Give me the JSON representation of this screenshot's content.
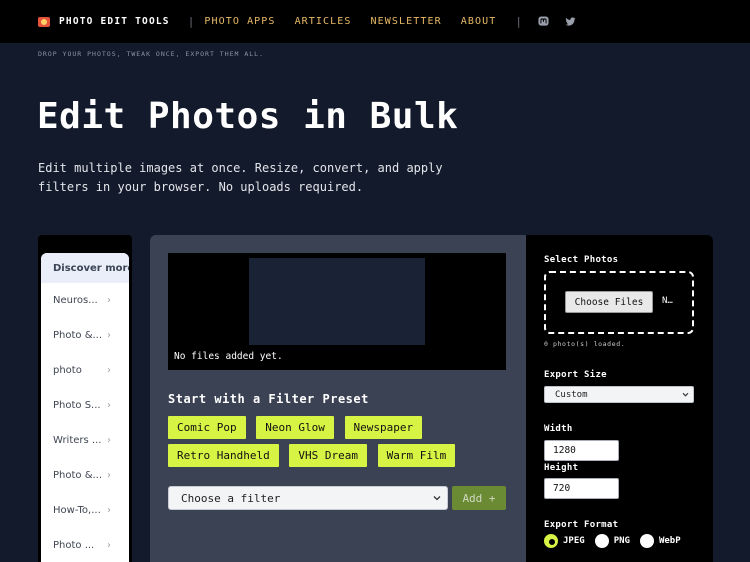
{
  "header": {
    "brand": "PHOTO EDIT TOOLS",
    "nav": [
      "PHOTO APPS",
      "ARTICLES",
      "NEWSLETTER",
      "ABOUT"
    ],
    "separator": "|",
    "social": [
      "mastodon-icon",
      "twitter-icon"
    ],
    "tagline": "DROP YOUR PHOTOS, TWEAK ONCE, EXPORT THEM ALL."
  },
  "hero": {
    "title": "Edit Photos in Bulk",
    "description": "Edit multiple images at once. Resize, convert, and apply filters in your browser. No uploads required."
  },
  "ads": {
    "header": "Discover more",
    "items": [
      "Neuros...",
      "Photo &...",
      "photo",
      "Photo S...",
      "Writers ...",
      "Photo &...",
      "How-To,...",
      "Photo ..."
    ]
  },
  "editor": {
    "preview_status": "No files added yet.",
    "preset_title": "Start with a Filter Preset",
    "presets": [
      "Comic Pop",
      "Neon Glow",
      "Newspaper",
      "Retro Handheld",
      "VHS Dream",
      "Warm Film"
    ],
    "filter_select": "Choose a filter",
    "add_label": "Add +"
  },
  "settings": {
    "select_photos_label": "Select Photos",
    "choose_files_label": "Choose Files",
    "choose_files_status": "N…",
    "loaded_count": "0 photo(s) loaded.",
    "export_size_label": "Export Size",
    "export_size_value": "Custom",
    "width_label": "Width",
    "width_value": "1280",
    "height_label": "Height",
    "height_value": "720",
    "export_format_label": "Export Format",
    "formats": [
      {
        "label": "JPEG",
        "checked": true
      },
      {
        "label": "PNG",
        "checked": false
      },
      {
        "label": "WebP",
        "checked": false
      }
    ]
  },
  "colors": {
    "background": "#121a2b",
    "accent": "#d7f444",
    "nav_link": "#e8b965",
    "panel": "#3a4254"
  }
}
